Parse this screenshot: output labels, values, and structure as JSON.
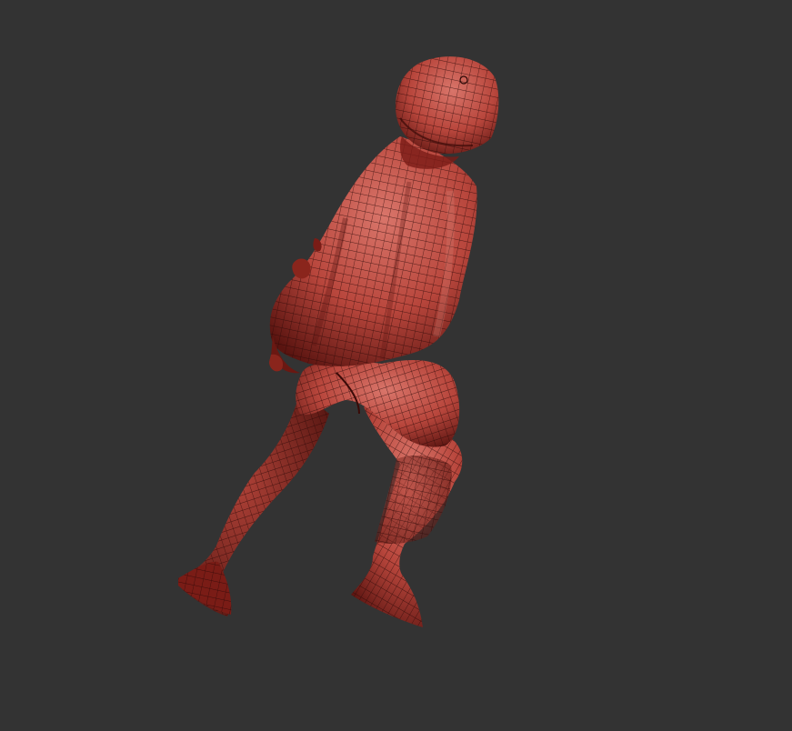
{
  "viewport": {
    "background": "#333333"
  },
  "model": {
    "base_color": "#b8463c",
    "light_color": "#d9756a",
    "shadow_color": "#5a1410",
    "wire_color": "#2a0806"
  }
}
